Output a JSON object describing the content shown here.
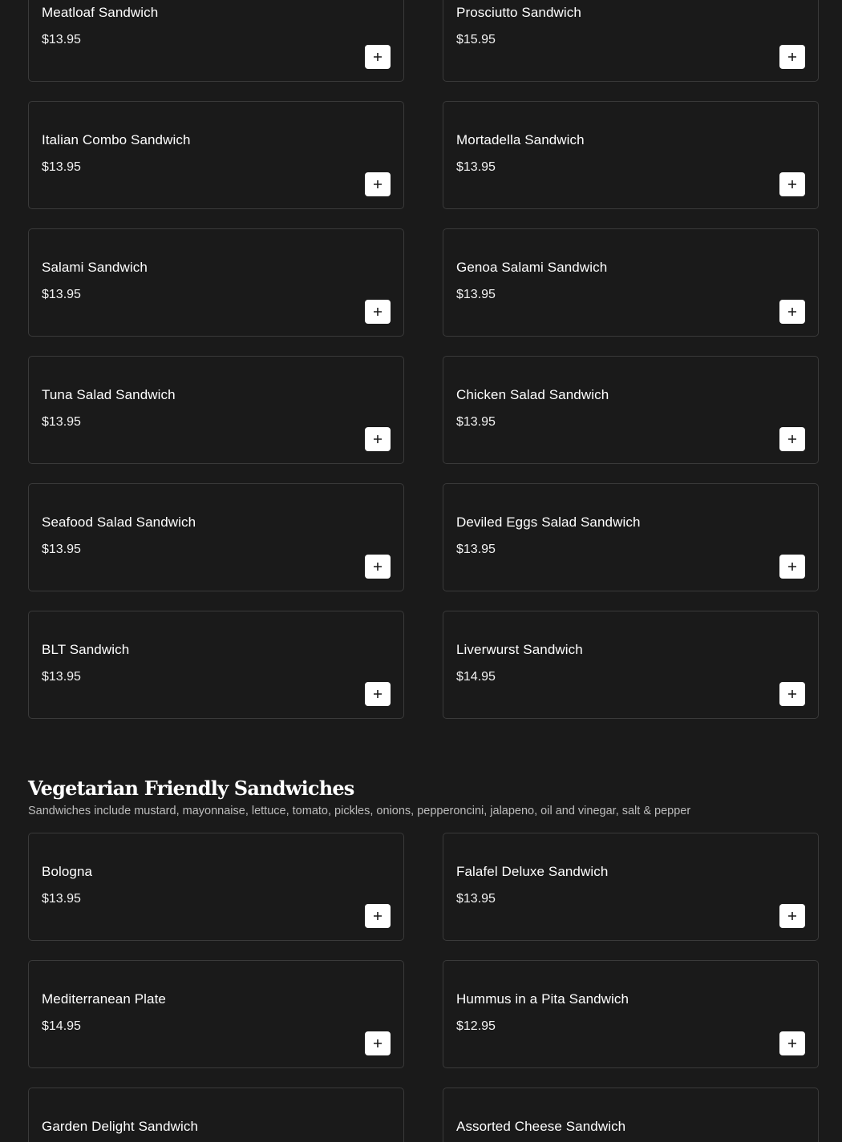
{
  "add_button_symbol": "+",
  "top_items": [
    {
      "name": "Meatloaf Sandwich",
      "price": "$13.95"
    },
    {
      "name": "Prosciutto Sandwich",
      "price": "$15.95"
    },
    {
      "name": "Italian Combo Sandwich",
      "price": "$13.95"
    },
    {
      "name": "Mortadella Sandwich",
      "price": "$13.95"
    },
    {
      "name": "Salami Sandwich",
      "price": "$13.95"
    },
    {
      "name": "Genoa Salami Sandwich",
      "price": "$13.95"
    },
    {
      "name": "Tuna Salad Sandwich",
      "price": "$13.95"
    },
    {
      "name": "Chicken Salad Sandwich",
      "price": "$13.95"
    },
    {
      "name": "Seafood Salad Sandwich",
      "price": "$13.95"
    },
    {
      "name": "Deviled Eggs Salad Sandwich",
      "price": "$13.95"
    },
    {
      "name": "BLT Sandwich",
      "price": "$13.95"
    },
    {
      "name": "Liverwurst Sandwich",
      "price": "$14.95"
    }
  ],
  "vegetarian_section": {
    "title": "Vegetarian Friendly Sandwiches",
    "description": "Sandwiches include mustard, mayonnaise, lettuce, tomato, pickles, onions, pepperoncini, jalapeno, oil and vinegar, salt & pepper",
    "items": [
      {
        "name": "Bologna",
        "price": "$13.95"
      },
      {
        "name": "Falafel Deluxe Sandwich",
        "price": "$13.95"
      },
      {
        "name": "Mediterranean Plate",
        "price": "$14.95"
      },
      {
        "name": "Hummus in a Pita Sandwich",
        "price": "$12.95"
      },
      {
        "name": "Garden Delight Sandwich",
        "price": ""
      },
      {
        "name": "Assorted Cheese Sandwich",
        "price": ""
      }
    ]
  },
  "colors": {
    "background": "#1a1a1a",
    "card_border": "#3a3a3a",
    "text": "#ffffff",
    "muted_text": "#bdbdbd",
    "button_bg": "#ffffff",
    "button_icon": "#1a1a1a"
  }
}
